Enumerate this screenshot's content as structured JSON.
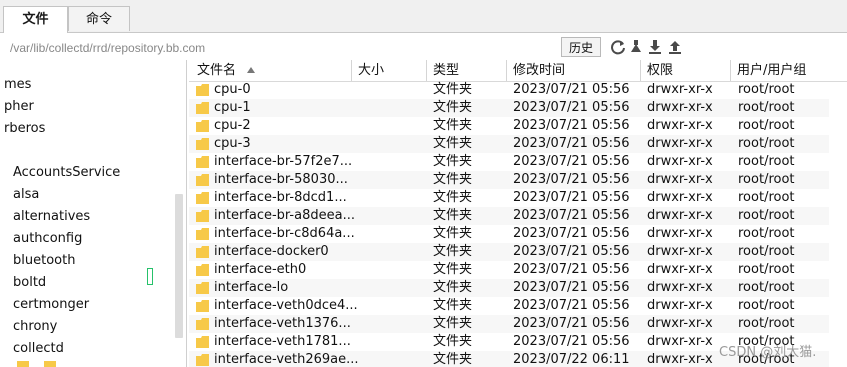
{
  "tabs": [
    {
      "label": "文件",
      "active": true
    },
    {
      "label": "命令",
      "active": false
    }
  ],
  "path": {
    "value": "/var/lib/collectd/rrd/repository.bb.com"
  },
  "toolbar": {
    "history_label": "历史",
    "icons": [
      "refresh-icon",
      "upload-arrow-icon",
      "download-icon",
      "upload-icon"
    ]
  },
  "tree": {
    "items": [
      "mes",
      "pher",
      "rberos",
      "",
      "AccountsService",
      "alsa",
      "alternatives",
      "authconfig",
      "bluetooth",
      "boltd",
      "certmonger",
      "chrony",
      "collectd"
    ]
  },
  "table": {
    "columns": [
      "文件名",
      "大小",
      "类型",
      "修改时间",
      "权限",
      "用户/用户组"
    ],
    "rows": [
      {
        "name": "cpu-0",
        "size": "",
        "type": "文件夹",
        "modified": "2023/07/21 05:56",
        "perm": "drwxr-xr-x",
        "owner": "root/root"
      },
      {
        "name": "cpu-1",
        "size": "",
        "type": "文件夹",
        "modified": "2023/07/21 05:56",
        "perm": "drwxr-xr-x",
        "owner": "root/root"
      },
      {
        "name": "cpu-2",
        "size": "",
        "type": "文件夹",
        "modified": "2023/07/21 05:56",
        "perm": "drwxr-xr-x",
        "owner": "root/root"
      },
      {
        "name": "cpu-3",
        "size": "",
        "type": "文件夹",
        "modified": "2023/07/21 05:56",
        "perm": "drwxr-xr-x",
        "owner": "root/root"
      },
      {
        "name": "interface-br-57f2e7...",
        "size": "",
        "type": "文件夹",
        "modified": "2023/07/21 05:56",
        "perm": "drwxr-xr-x",
        "owner": "root/root"
      },
      {
        "name": "interface-br-58030...",
        "size": "",
        "type": "文件夹",
        "modified": "2023/07/21 05:56",
        "perm": "drwxr-xr-x",
        "owner": "root/root"
      },
      {
        "name": "interface-br-8dcd1...",
        "size": "",
        "type": "文件夹",
        "modified": "2023/07/21 05:56",
        "perm": "drwxr-xr-x",
        "owner": "root/root"
      },
      {
        "name": "interface-br-a8deea...",
        "size": "",
        "type": "文件夹",
        "modified": "2023/07/21 05:56",
        "perm": "drwxr-xr-x",
        "owner": "root/root"
      },
      {
        "name": "interface-br-c8d64a...",
        "size": "",
        "type": "文件夹",
        "modified": "2023/07/21 05:56",
        "perm": "drwxr-xr-x",
        "owner": "root/root"
      },
      {
        "name": "interface-docker0",
        "size": "",
        "type": "文件夹",
        "modified": "2023/07/21 05:56",
        "perm": "drwxr-xr-x",
        "owner": "root/root"
      },
      {
        "name": "interface-eth0",
        "size": "",
        "type": "文件夹",
        "modified": "2023/07/21 05:56",
        "perm": "drwxr-xr-x",
        "owner": "root/root"
      },
      {
        "name": "interface-lo",
        "size": "",
        "type": "文件夹",
        "modified": "2023/07/21 05:56",
        "perm": "drwxr-xr-x",
        "owner": "root/root"
      },
      {
        "name": "interface-veth0dce4...",
        "size": "",
        "type": "文件夹",
        "modified": "2023/07/21 05:56",
        "perm": "drwxr-xr-x",
        "owner": "root/root"
      },
      {
        "name": "interface-veth1376...",
        "size": "",
        "type": "文件夹",
        "modified": "2023/07/21 05:56",
        "perm": "drwxr-xr-x",
        "owner": "root/root"
      },
      {
        "name": "interface-veth1781...",
        "size": "",
        "type": "文件夹",
        "modified": "2023/07/21 05:56",
        "perm": "drwxr-xr-x",
        "owner": "root/root"
      },
      {
        "name": "interface-veth269ae...",
        "size": "",
        "type": "文件夹",
        "modified": "2023/07/22 06:11",
        "perm": "drwxr-xr-x",
        "owner": "root/root"
      }
    ]
  },
  "watermark": "CSDN @刘大猫.",
  "colors": {
    "folder": "#f7c948",
    "accent": "#2d6cc0"
  }
}
